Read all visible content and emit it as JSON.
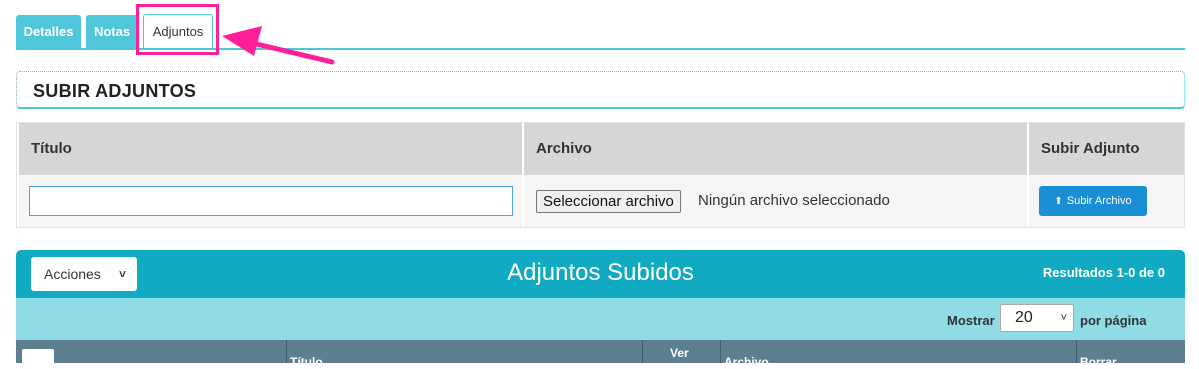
{
  "tabs": [
    {
      "label": "Detalles"
    },
    {
      "label": "Notas"
    },
    {
      "label": "Adjuntos",
      "active": true
    }
  ],
  "upload_section": {
    "title": "SUBIR ADJUNTOS",
    "columns": [
      "Título",
      "Archivo",
      "Subir Adjunto"
    ],
    "title_value": "",
    "file_button_label": "Seleccionar archivo",
    "file_status": "Ningún archivo seleccionado",
    "upload_button_label": "Subir Archivo",
    "upload_icon": "upload-icon"
  },
  "attachments_panel": {
    "actions_label": "Acciones",
    "title": "Adjuntos Subidos",
    "results": "Resultados 1-0 de 0",
    "show_label": "Mostrar",
    "per_page_value": "20",
    "per_page_suffix": "por página",
    "columns": [
      "Título",
      "Ver",
      "Archivo",
      "Borrar"
    ]
  },
  "colors": {
    "tab_accent": "#4fc6da",
    "panel_header": "#10abc3",
    "panel_subbar": "#8fdbe6",
    "column_header": "#5d7f8f",
    "upload_button": "#1a8fd6",
    "highlight": "#ff1f9a"
  }
}
